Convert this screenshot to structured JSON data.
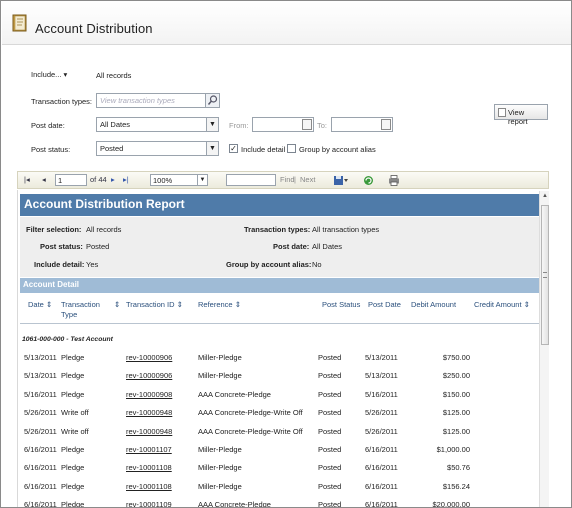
{
  "header": {
    "title": "Account Distribution",
    "icon": "book-icon"
  },
  "filters": {
    "include_label": "Include...",
    "include_value": "All records",
    "transaction_types_label": "Transaction types:",
    "transaction_types_placeholder": "View transaction types",
    "post_date_label": "Post date:",
    "post_date_value": "All Dates",
    "from_label": "From:",
    "to_label": "To:",
    "post_status_label": "Post status:",
    "post_status_value": "Posted",
    "include_detail_label": "Include detail",
    "include_detail_checked": true,
    "group_alias_label": "Group by account alias",
    "group_alias_checked": false,
    "view_report_label": "View report"
  },
  "toolbar": {
    "page_current": "1",
    "page_of": "of 44",
    "zoom": "100%",
    "find_label": "Find",
    "separator": "|",
    "next_label": "Next"
  },
  "report": {
    "title": "Account Distribution Report",
    "summary": {
      "filter_selection_label": "Filter selection:",
      "filter_selection_value": "All records",
      "transaction_types_label": "Transaction types:",
      "transaction_types_value": "All transaction types",
      "post_status_label": "Post status:",
      "post_status_value": "Posted",
      "post_date_label": "Post date:",
      "post_date_value": "All Dates",
      "include_detail_label": "Include detail:",
      "include_detail_value": "Yes",
      "group_alias_label": "Group by account alias:",
      "group_alias_value": "No"
    },
    "section_title": "Account Detail",
    "columns": {
      "date": "Date",
      "transaction_type": "Transaction Type",
      "transaction_id": "Transaction ID",
      "reference": "Reference",
      "post_status": "Post Status",
      "post_date": "Post Date",
      "debit_amount": "Debit Amount",
      "credit_amount": "Credit Amount"
    },
    "group_label": "1061-000-000 - Test Account",
    "rows": [
      {
        "date": "5/13/2011",
        "type": "Pledge",
        "id": "rev-10000906",
        "ref": "Miller-Pledge",
        "status": "Posted",
        "post_date": "5/13/2011",
        "debit": "$750.00",
        "credit": ""
      },
      {
        "date": "5/13/2011",
        "type": "Pledge",
        "id": "rev-10000906",
        "ref": "Miller-Pledge",
        "status": "Posted",
        "post_date": "5/13/2011",
        "debit": "$250.00",
        "credit": ""
      },
      {
        "date": "5/16/2011",
        "type": "Pledge",
        "id": "rev-10000908",
        "ref": "AAA Concrete-Pledge",
        "status": "Posted",
        "post_date": "5/16/2011",
        "debit": "$150.00",
        "credit": ""
      },
      {
        "date": "5/26/2011",
        "type": "Write off",
        "id": "rev-10000948",
        "ref": "AAA Concrete-Pledge-Write Off",
        "status": "Posted",
        "post_date": "5/26/2011",
        "debit": "$125.00",
        "credit": ""
      },
      {
        "date": "5/26/2011",
        "type": "Write off",
        "id": "rev-10000948",
        "ref": "AAA Concrete-Pledge-Write Off",
        "status": "Posted",
        "post_date": "5/26/2011",
        "debit": "$125.00",
        "credit": ""
      },
      {
        "date": "6/16/2011",
        "type": "Pledge",
        "id": "rev-10001107",
        "ref": "Miller-Pledge",
        "status": "Posted",
        "post_date": "6/16/2011",
        "debit": "$1,000.00",
        "credit": ""
      },
      {
        "date": "6/16/2011",
        "type": "Pledge",
        "id": "rev-10001108",
        "ref": "Miller-Pledge",
        "status": "Posted",
        "post_date": "6/16/2011",
        "debit": "$50.76",
        "credit": ""
      },
      {
        "date": "6/16/2011",
        "type": "Pledge",
        "id": "rev-10001108",
        "ref": "Miller-Pledge",
        "status": "Posted",
        "post_date": "6/16/2011",
        "debit": "$156.24",
        "credit": ""
      },
      {
        "date": "6/16/2011",
        "type": "Pledge",
        "id": "rev-10001109",
        "ref": "AAA Concrete-Pledge",
        "status": "Posted",
        "post_date": "6/16/2011",
        "debit": "$20,000.00",
        "credit": ""
      }
    ]
  },
  "colors": {
    "report_title_bg": "#4f7ba9",
    "section_bg": "#9fbbd6",
    "summary_bg": "#eeeeee"
  }
}
